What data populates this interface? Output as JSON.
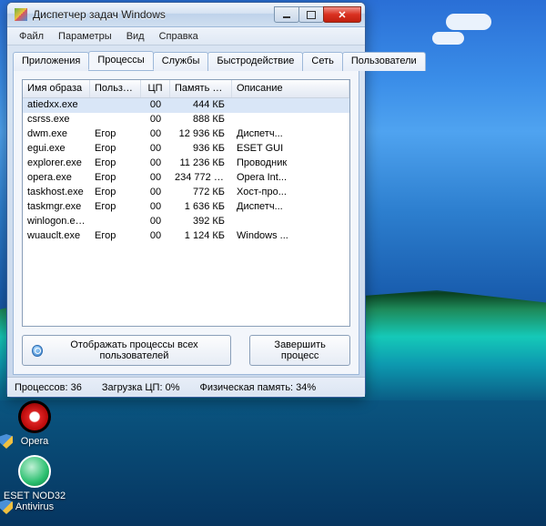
{
  "window": {
    "title": "Диспетчер задач Windows"
  },
  "menu": {
    "items": [
      "Файл",
      "Параметры",
      "Вид",
      "Справка"
    ]
  },
  "tabs": {
    "items": [
      "Приложения",
      "Процессы",
      "Службы",
      "Быстродействие",
      "Сеть",
      "Пользователи"
    ],
    "active_index": 1
  },
  "columns": {
    "name": "Имя образа",
    "user": "Пользо...",
    "cpu": "ЦП",
    "mem": "Память (...",
    "desc": "Описание"
  },
  "processes": [
    {
      "name": "atiedxx.exe",
      "user": "",
      "cpu": "00",
      "mem": "444 КБ",
      "desc": "",
      "selected": true
    },
    {
      "name": "csrss.exe",
      "user": "",
      "cpu": "00",
      "mem": "888 КБ",
      "desc": ""
    },
    {
      "name": "dwm.exe",
      "user": "Егор",
      "cpu": "00",
      "mem": "12 936 КБ",
      "desc": "Диспетч..."
    },
    {
      "name": "egui.exe",
      "user": "Егор",
      "cpu": "00",
      "mem": "936 КБ",
      "desc": "ESET GUI"
    },
    {
      "name": "explorer.exe",
      "user": "Егор",
      "cpu": "00",
      "mem": "11 236 КБ",
      "desc": "Проводник"
    },
    {
      "name": "opera.exe",
      "user": "Егор",
      "cpu": "00",
      "mem": "234 772 КБ",
      "desc": "Opera Int..."
    },
    {
      "name": "taskhost.exe",
      "user": "Егор",
      "cpu": "00",
      "mem": "772 КБ",
      "desc": "Хост-про..."
    },
    {
      "name": "taskmgr.exe",
      "user": "Егор",
      "cpu": "00",
      "mem": "1 636 КБ",
      "desc": "Диспетч..."
    },
    {
      "name": "winlogon.exe",
      "user": "",
      "cpu": "00",
      "mem": "392 КБ",
      "desc": ""
    },
    {
      "name": "wuauclt.exe",
      "user": "Егор",
      "cpu": "00",
      "mem": "1 124 КБ",
      "desc": "Windows ..."
    }
  ],
  "buttons": {
    "show_all": "Отображать процессы всех пользователей",
    "end_process": "Завершить процесс"
  },
  "status": {
    "processes": "Процессов: 36",
    "cpu": "Загрузка ЦП: 0%",
    "mem": "Физическая память: 34%"
  },
  "desktop_icons": {
    "opera": "Opera",
    "eset": "ESET NOD32 Antivirus"
  }
}
